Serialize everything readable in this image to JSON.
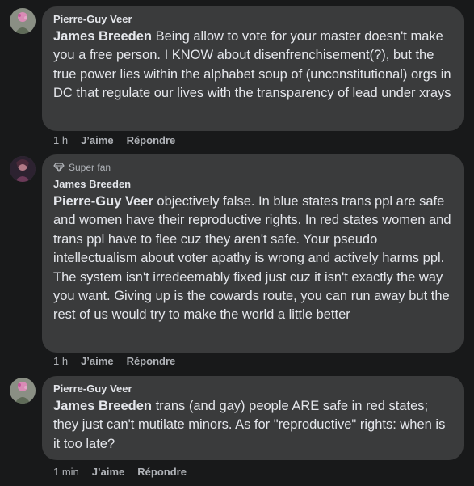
{
  "comments": [
    {
      "author": "Pierre-Guy Veer",
      "mention": "James Breeden",
      "text": " Being allow to vote for your master doesn't make you a free person. I KNOW about disenfrenchisement(?), but the true power lies within the alphabet soup of (unconstitutional) orgs in DC that regulate our lives with the transparency of lead under xrays",
      "time": "1 h",
      "like": "J’aime",
      "reply": "Répondre"
    },
    {
      "badge": "Super fan",
      "author": "James Breeden",
      "mention": "Pierre-Guy Veer",
      "text": " objectively false. In blue states trans ppl are safe and women have their reproductive rights. In red states women and trans ppl have to flee cuz they aren't safe. Your pseudo intellectualism about voter apathy is wrong and actively harms ppl. The system isn't irredeemably fixed just cuz it isn't exactly the way you want. Giving up is the cowards route, you can run away but the rest of us would try to make the world a little better",
      "time": "1 h",
      "like": "J’aime",
      "reply": "Répondre"
    },
    {
      "author": "Pierre-Guy Veer",
      "mention": "James Breeden",
      "text": " trans (and gay) people ARE safe in red states; they just can't mutilate minors. As for \"reproductive\" rights: when is it too late?",
      "time": "1 min",
      "like": "J’aime",
      "reply": "Répondre"
    }
  ]
}
